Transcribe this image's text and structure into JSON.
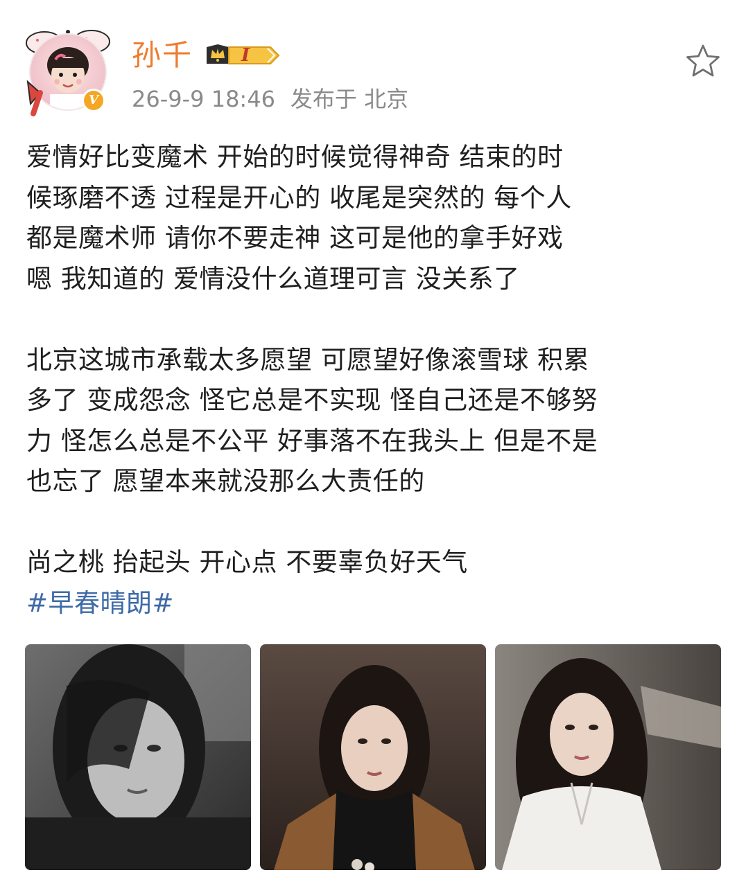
{
  "post": {
    "author": {
      "name": "孙千",
      "member_level": "I",
      "verified_mark": "V",
      "avatar_icon": "avatar-girl-icon"
    },
    "meta": {
      "timestamp": "26-9-9 18:46",
      "location": "发布于 北京"
    },
    "favorite_icon": "star-outline-icon",
    "paragraphs": [
      "爱情好比变魔术 开始的时候觉得神奇 结束的时\n候琢磨不透 过程是开心的 收尾是突然的 每个人\n都是魔术师 请你不要走神 这可是他的拿手好戏\n嗯 我知道的 爱情没什么道理可言 没关系了",
      "北京这城市承载太多愿望 可愿望好像滚雪球 积累\n多了 变成怨念 怪它总是不实现 怪自己还是不够努\n力 怪怎么总是不公平 好事落不在我头上 但是不是\n也忘了 愿望本来就没那么大责任的",
      "尚之桃 抬起头 开心点 不要辜负好天气"
    ],
    "hashtag": "#早春晴朗#",
    "colors": {
      "username": "#ef7b2d",
      "hashtag": "#3f6aa8",
      "meta": "#8a8a8a",
      "text": "#1f1f1f"
    }
  }
}
